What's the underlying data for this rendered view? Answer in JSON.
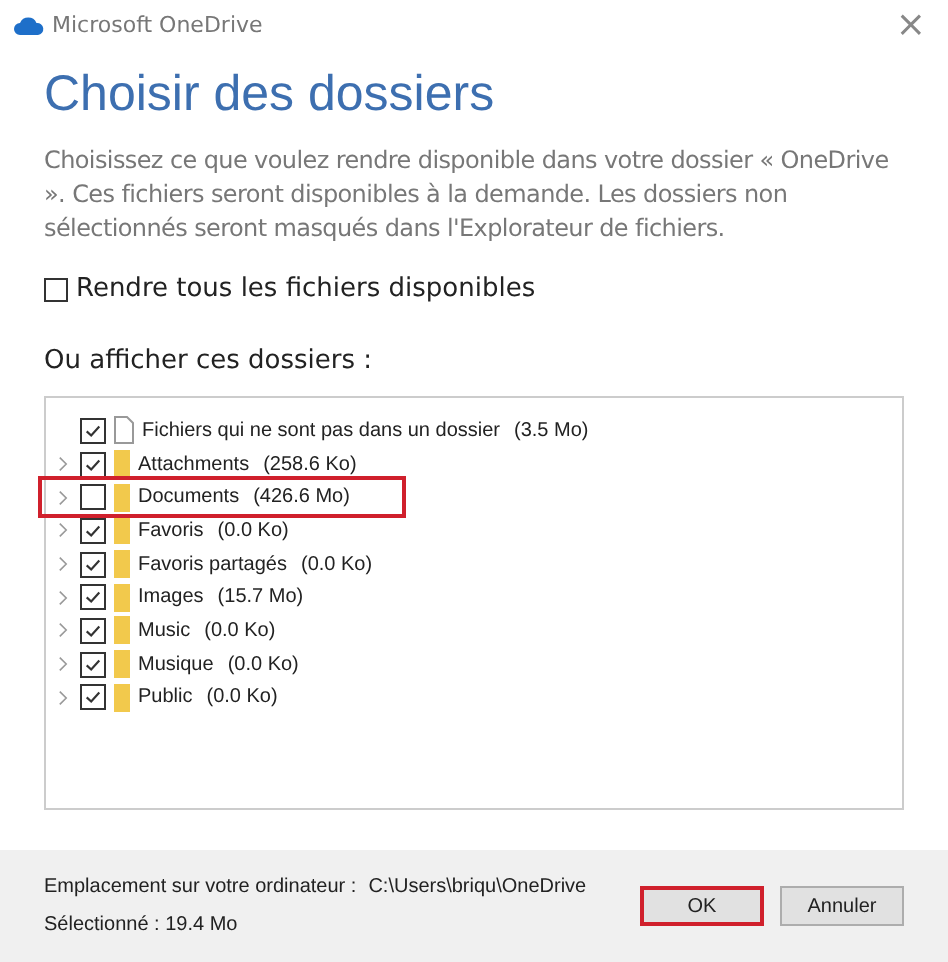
{
  "window": {
    "title": "Microsoft OneDrive",
    "close": "×"
  },
  "heading": "Choisir des dossiers",
  "description": "Choisissez ce que voulez rendre disponible dans votre dossier « OneDrive ». Ces fichiers seront disponibles à la demande. Les dossiers non sélectionnés seront masqués dans l'Explorateur de fichiers.",
  "all_files": {
    "label": "Rendre tous les fichiers disponibles",
    "checked": false
  },
  "tree_label": "Ou afficher ces dossiers :",
  "tree": [
    {
      "kind": "file",
      "name": "Fichiers qui ne sont pas dans un dossier",
      "size": "(3.5 Mo)",
      "checked": true,
      "highlighted": false
    },
    {
      "kind": "folder",
      "name": "Attachments",
      "size": "(258.6 Ko)",
      "checked": true,
      "highlighted": false
    },
    {
      "kind": "folder",
      "name": "Documents",
      "size": "(426.6 Mo)",
      "checked": false,
      "highlighted": true
    },
    {
      "kind": "folder",
      "name": "Favoris",
      "size": "(0.0 Ko)",
      "checked": true,
      "highlighted": false
    },
    {
      "kind": "folder",
      "name": "Favoris partagés",
      "size": "(0.0 Ko)",
      "checked": true,
      "highlighted": false
    },
    {
      "kind": "folder",
      "name": "Images",
      "size": "(15.7 Mo)",
      "checked": true,
      "highlighted": false
    },
    {
      "kind": "folder",
      "name": "Music",
      "size": "(0.0 Ko)",
      "checked": true,
      "highlighted": false
    },
    {
      "kind": "folder",
      "name": "Musique",
      "size": "(0.0 Ko)",
      "checked": true,
      "highlighted": false
    },
    {
      "kind": "folder",
      "name": "Public",
      "size": "(0.0 Ko)",
      "checked": true,
      "highlighted": false
    }
  ],
  "footer": {
    "location_label": "Emplacement sur votre ordinateur :",
    "location": "C:\\Users\\briqu\\OneDrive",
    "selected": "Sélectionné : 19.4 Mo"
  },
  "buttons": [
    {
      "label": "OK",
      "highlighted": true
    },
    {
      "label": "Annuler",
      "highlighted": false
    }
  ]
}
